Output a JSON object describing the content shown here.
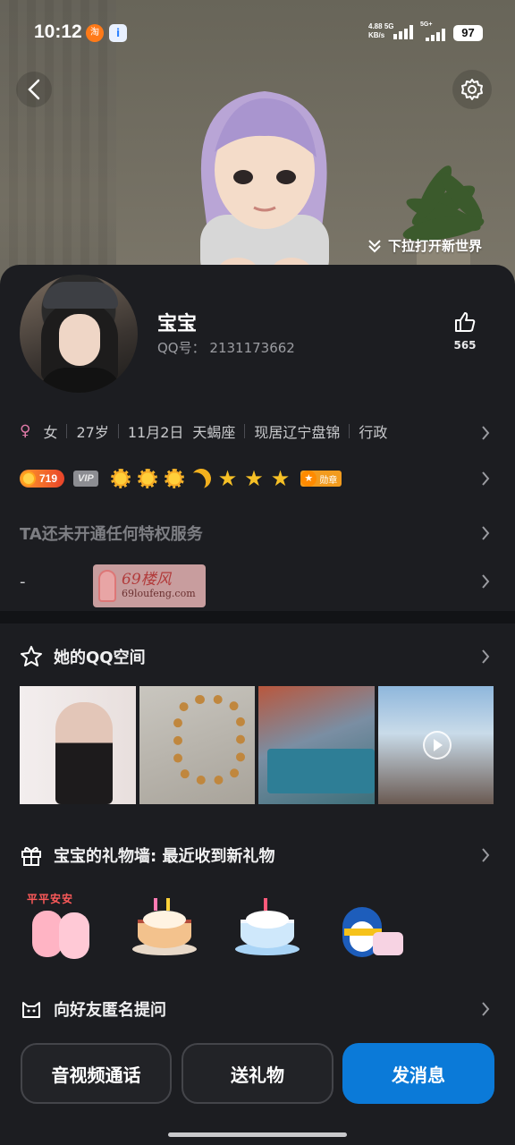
{
  "status_bar": {
    "time": "10:12",
    "net_speed": "4.88",
    "net_unit": "KB/s",
    "net_type_1": "5G",
    "net_type_2": "5G+",
    "battery": "97"
  },
  "hero": {
    "pull_hint": "下拉打开新世界"
  },
  "profile": {
    "nickname": "宝宝",
    "qq_label": "QQ号：",
    "qq_number": "2131173662",
    "like_count": "565",
    "info": {
      "gender": "女",
      "age": "27岁",
      "birthday": "11月2日",
      "zodiac": "天蝎座",
      "location": "现居辽宁盘锦",
      "job": "行政"
    },
    "level": "719",
    "vip_label": "VIP",
    "medal_label": "勋章",
    "privilege_text": "TA还未开通任何特权服务",
    "signature": "-"
  },
  "watermark": {
    "title": "69楼风",
    "url": "69loufeng.com"
  },
  "qzone": {
    "title": "她的QQ空间"
  },
  "gift_wall": {
    "title": "宝宝的礼物墙: 最近收到新礼物",
    "gift_1_text": "平平安安"
  },
  "ask": {
    "title": "向好友匿名提问"
  },
  "actions": {
    "call": "音视频通话",
    "gift": "送礼物",
    "message": "发消息"
  },
  "colors": {
    "accent": "#0b7ad8",
    "background": "#1c1d21"
  }
}
